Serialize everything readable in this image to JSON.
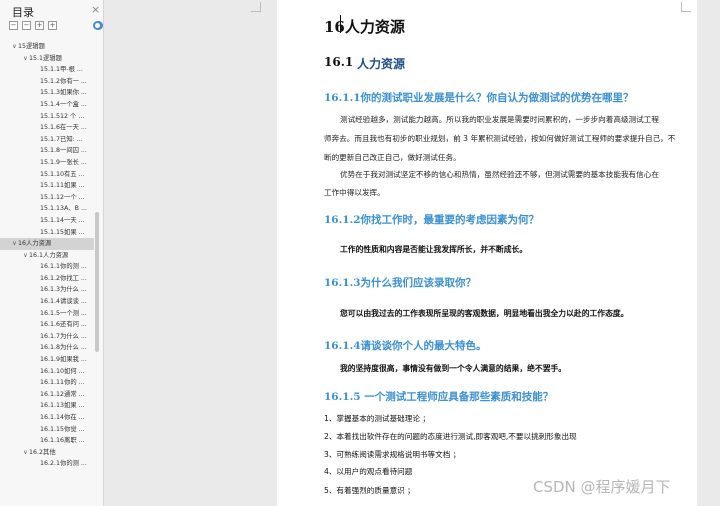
{
  "nav": {
    "title": "目录",
    "close_glyph": "×",
    "tool_buttons": [
      "−",
      "−",
      "+",
      "+"
    ],
    "toc": [
      {
        "level": 0,
        "arrow": "∨",
        "label": "15逻辑题"
      },
      {
        "level": 1,
        "arrow": "∨",
        "label": "15.1逻辑题"
      },
      {
        "level": 2,
        "arrow": "",
        "label": "15.1.1甲-根 ..."
      },
      {
        "level": 2,
        "arrow": "",
        "label": "15.1.2你有一 ..."
      },
      {
        "level": 2,
        "arrow": "",
        "label": "15.1.3如果你 ..."
      },
      {
        "level": 2,
        "arrow": "",
        "label": "15.1.4一个盒 ..."
      },
      {
        "level": 2,
        "arrow": "",
        "label": "15.1.512 个 ..."
      },
      {
        "level": 2,
        "arrow": "",
        "label": "15.1.6在一天 ..."
      },
      {
        "level": 2,
        "arrow": "",
        "label": "15.1.7已知: ..."
      },
      {
        "level": 2,
        "arrow": "",
        "label": "15.1.8一间囚 ..."
      },
      {
        "level": 2,
        "arrow": "",
        "label": "15.1.9一张长 ..."
      },
      {
        "level": 2,
        "arrow": "",
        "label": "15.1.10有五 ..."
      },
      {
        "level": 2,
        "arrow": "",
        "label": "15.1.11如果 ..."
      },
      {
        "level": 2,
        "arrow": "",
        "label": "15.1.12一个 ..."
      },
      {
        "level": 2,
        "arrow": "",
        "label": "15.1.13A、B ..."
      },
      {
        "level": 2,
        "arrow": "",
        "label": "15.1.14一天 ..."
      },
      {
        "level": 2,
        "arrow": "",
        "label": "15.1.15如果 ..."
      },
      {
        "level": 0,
        "arrow": "∨",
        "label": "16人力资源",
        "selected": true
      },
      {
        "level": 1,
        "arrow": "∨",
        "label": "16.1人力资源"
      },
      {
        "level": 2,
        "arrow": "",
        "label": "16.1.1你的测 ..."
      },
      {
        "level": 2,
        "arrow": "",
        "label": "16.1.2你找工 ..."
      },
      {
        "level": 2,
        "arrow": "",
        "label": "16.1.3为什么 ..."
      },
      {
        "level": 2,
        "arrow": "",
        "label": "16.1.4请谈谈 ..."
      },
      {
        "level": 2,
        "arrow": "",
        "label": "16.1.5一个测 ..."
      },
      {
        "level": 2,
        "arrow": "",
        "label": "16.1.6还有问 ..."
      },
      {
        "level": 2,
        "arrow": "",
        "label": "16.1.7为什么 ..."
      },
      {
        "level": 2,
        "arrow": "",
        "label": "16.1.8为什么 ..."
      },
      {
        "level": 2,
        "arrow": "",
        "label": "16.1.9如果我 ..."
      },
      {
        "level": 2,
        "arrow": "",
        "label": "16.1.10如何 ..."
      },
      {
        "level": 2,
        "arrow": "",
        "label": "16.1.11你的 ..."
      },
      {
        "level": 2,
        "arrow": "",
        "label": "16.1.12通常 ..."
      },
      {
        "level": 2,
        "arrow": "",
        "label": "16.1.13如果 ..."
      },
      {
        "level": 2,
        "arrow": "",
        "label": "16.1.14你在 ..."
      },
      {
        "level": 2,
        "arrow": "",
        "label": "16.1.15你觉 ..."
      },
      {
        "level": 2,
        "arrow": "",
        "label": "16.1.16离职 ..."
      },
      {
        "level": 1,
        "arrow": "∨",
        "label": "16.2其他"
      },
      {
        "level": 2,
        "arrow": "",
        "label": "16.2.1你的测 ..."
      }
    ]
  },
  "document": {
    "chapter_title": "16人力资源",
    "section_num": "16.1",
    "section_title": "人力资源",
    "q1": {
      "title": "16.1.1你的测试职业发展是什么？你自认为做测试的优势在哪里？",
      "para1": [
        "测试经验越多，测试能力越高。所以我的职业发展是需要时间累积的，一步步向着高级测试工程",
        "师奔去。而且我也有初步的职业规划，前 3 年累积测试经验，按如何做好测试工程师的要求提升自己，不",
        "断的更新自己改正自己，做好测试任务。"
      ],
      "para2": [
        "优势在于我对测试坚定不移的信心和热情，虽然经验还不够，但测试需要的基本技能我有信心在",
        "工作中得以发挥。"
      ]
    },
    "q2": {
      "title": "16.1.2你找工作时，最重要的考虑因素为何？",
      "answer": "工作的性质和内容是否能让我发挥所长，并不断成长。"
    },
    "q3": {
      "title": "16.1.3为什么我们应该录取你？",
      "answer": "您可以由我过去的工作表现所呈现的客观数据，明显地看出我全力以赴的工作态度。"
    },
    "q4": {
      "title": "16.1.4请谈谈你个人的最大特色。",
      "answer": "我的坚持度很高，事情没有做到一个令人满意的结果，绝不罢手。"
    },
    "q5": {
      "title": "16.1.5 一个测试工程师应具备那些素质和技能？",
      "items": [
        "1、掌握基本的测试基础理论 ；",
        "2、本着找出软件存在的问题的态度进行测试,即客观吧,不要以挑刺形象出现",
        "3、可熟练阅读需求规格说明书等文档 ；",
        "4、以用户的观点看待问题",
        "5、有着强烈的质量意识 ；"
      ]
    }
  },
  "watermark": "CSDN @程序媛月下"
}
